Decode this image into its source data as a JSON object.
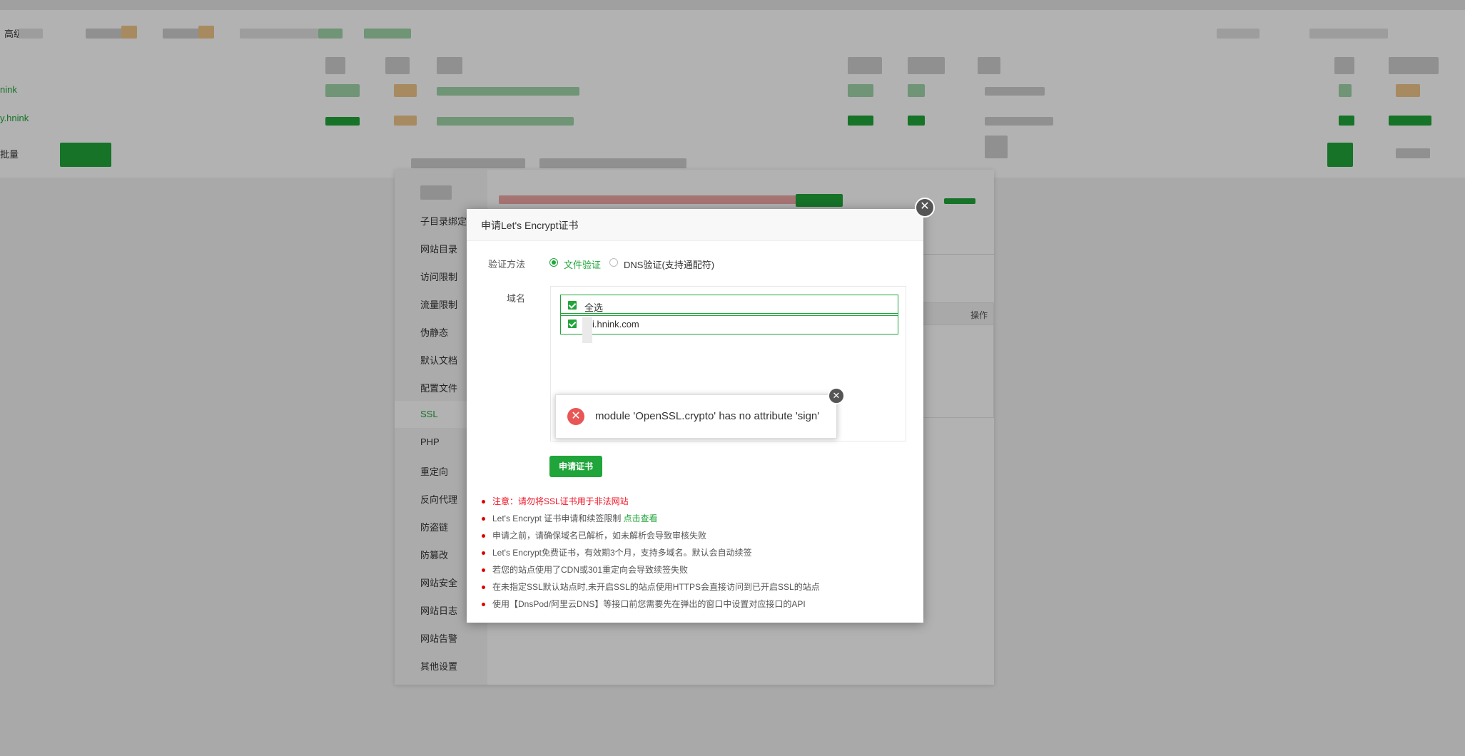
{
  "background_list": {
    "toolbar_label": "高级",
    "row_labels": [
      "",
      "nink",
      "y.hnink",
      "批量"
    ]
  },
  "site_settings": {
    "sidebar": [
      "子目录绑定",
      "网站目录",
      "访问限制",
      "流量限制",
      "伪静态",
      "默认文档",
      "配置文件",
      "SSL",
      "PHP",
      "重定向",
      "反向代理",
      "防盗链",
      "防篡改",
      "网站安全",
      "网站日志",
      "网站告警",
      "其他设置"
    ],
    "active_item": "SSL",
    "table_header_action": "操作"
  },
  "modal": {
    "title": "申请Let's Encrypt证书",
    "close_icon": "close-icon",
    "verify_label": "验证方法",
    "verify_options": [
      {
        "label": "文件验证",
        "selected": true
      },
      {
        "label": "DNS验证(支持通配符)",
        "selected": false
      }
    ],
    "domain_label": "域名",
    "domains": [
      {
        "label": "全选",
        "checked": true
      },
      {
        "label": "i.hnink.com",
        "checked": true
      }
    ],
    "apply_button": "申请证书",
    "tips": [
      {
        "text": "注意：请勿将SSL证书用于非法网站",
        "warn": true
      },
      {
        "text": "Let's Encrypt 证书申请和续签限制 ",
        "link": "点击查看"
      },
      {
        "text": "申请之前，请确保域名已解析，如未解析会导致审核失败"
      },
      {
        "text": "Let's Encrypt免费证书，有效期3个月，支持多域名。默认会自动续签"
      },
      {
        "text": "若您的站点使用了CDN或301重定向会导致续签失败"
      },
      {
        "text": "在未指定SSL默认站点时,未开启SSL的站点使用HTTPS会直接访问到已开启SSL的站点"
      },
      {
        "text": "使用【DnsPod/阿里云DNS】等接口前您需要先在弹出的窗口中设置对应接口的API"
      }
    ]
  },
  "toast": {
    "message": "module 'OpenSSL.crypto' has no attribute 'sign'",
    "icon": "error-icon",
    "close_icon": "close-icon"
  },
  "colors": {
    "accent": "#20a53a",
    "error": "#e85656",
    "warning_text": "#e12"
  }
}
